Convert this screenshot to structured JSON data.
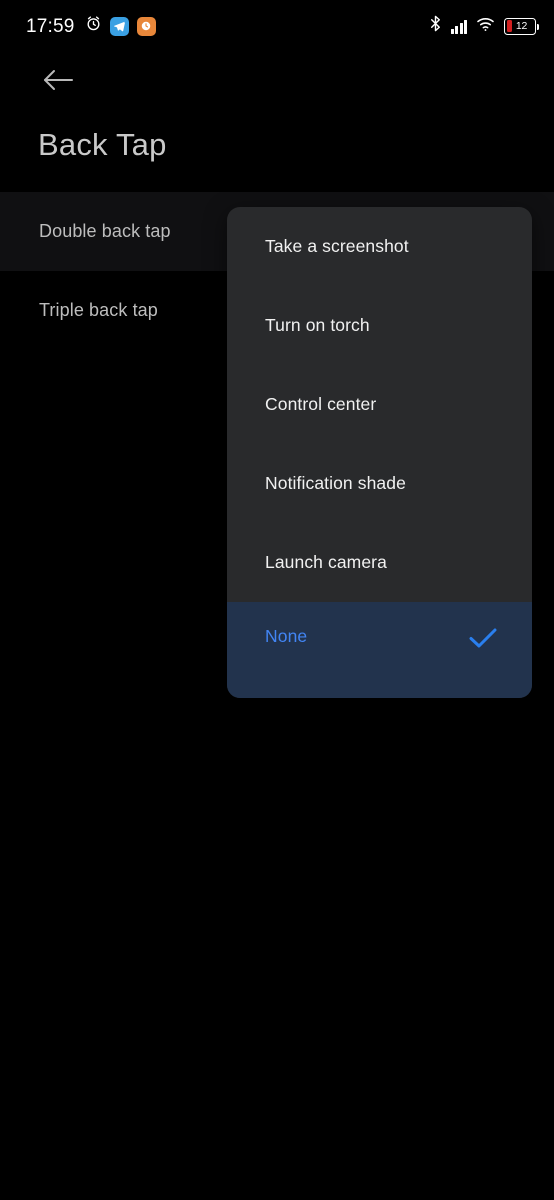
{
  "status_bar": {
    "clock": "17:59",
    "icons_left": [
      "alarm-icon",
      "telegram-app-icon",
      "orange-app-icon"
    ],
    "icons_right": [
      "bluetooth-icon",
      "cellular-signal-icon",
      "wifi-icon",
      "battery-icon"
    ],
    "battery_percent": "12",
    "battery_color": "#d32020"
  },
  "app_bar": {
    "back_icon": "arrow-left-icon",
    "title": "Back Tap"
  },
  "settings": {
    "rows": [
      {
        "label": "Double back tap",
        "pressed": true
      },
      {
        "label": "Triple back tap",
        "pressed": false
      }
    ]
  },
  "menu": {
    "background": "#292a2c",
    "selected_background": "#22334d",
    "accent": "#4285f4",
    "items": [
      {
        "label": "Take a screenshot",
        "selected": false
      },
      {
        "label": "Turn on torch",
        "selected": false
      },
      {
        "label": "Control center",
        "selected": false
      },
      {
        "label": "Notification shade",
        "selected": false
      },
      {
        "label": "Launch camera",
        "selected": false
      },
      {
        "label": "None",
        "selected": true
      }
    ],
    "check_icon": "check-icon"
  }
}
